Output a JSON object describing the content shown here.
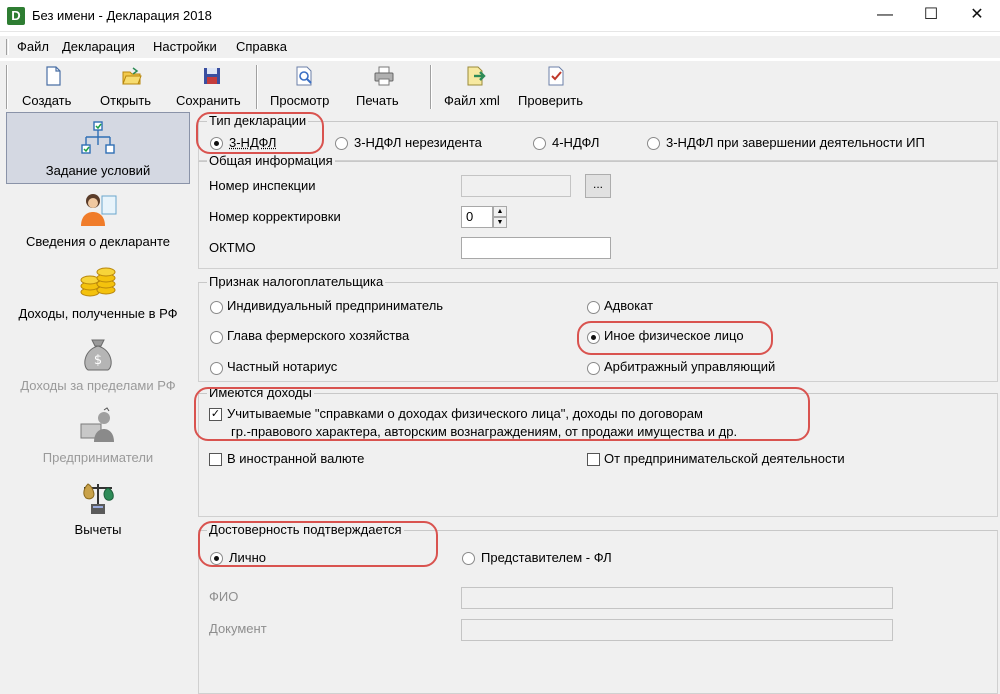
{
  "window": {
    "app_icon": "D",
    "title": "Без имени - Декларация 2018",
    "minimize": "—",
    "maximize": "☐",
    "close": "✕"
  },
  "menu": [
    "Файл",
    "Декларация",
    "Настройки",
    "Справка"
  ],
  "toolbar": {
    "create": "Создать",
    "open": "Открыть",
    "save": "Сохранить",
    "preview": "Просмотр",
    "print": "Печать",
    "xml": "Файл xml",
    "check": "Проверить"
  },
  "sidebar": {
    "items": [
      {
        "label": "Задание условий",
        "icon": "tree-icon"
      },
      {
        "label": "Сведения о декларанте",
        "icon": "person-icon"
      },
      {
        "label": "Доходы, полученные в РФ",
        "icon": "coins-icon"
      },
      {
        "label": "Доходы за пределами РФ",
        "icon": "money-bag-icon"
      },
      {
        "label": "Предприниматели",
        "icon": "entrepreneur-icon"
      },
      {
        "label": "Вычеты",
        "icon": "scales-icon"
      }
    ]
  },
  "decl_type": {
    "title": "Тип декларации",
    "options": [
      "3-НДФЛ",
      "3-НДФЛ нерезидента",
      "4-НДФЛ",
      "3-НДФЛ при завершении деятельности ИП"
    ],
    "selected": "3-НДФЛ"
  },
  "general": {
    "title": "Общая информация",
    "inspection_label": "Номер инспекции",
    "inspection_value": "",
    "browse_button": "...",
    "correction_label": "Номер корректировки",
    "correction_value": "0",
    "oktmo_label": "ОКТМО",
    "oktmo_value": ""
  },
  "taxpayer": {
    "title": "Признак налогоплательщика",
    "options": [
      "Индивидуальный предприниматель",
      "Адвокат",
      "Глава фермерского хозяйства",
      "Иное физическое лицо",
      "Частный нотариус",
      "Арбитражный управляющий"
    ],
    "selected": "Иное физическое лицо"
  },
  "income": {
    "title": "Имеются доходы",
    "main_line1": "Учитываемые \"справками о доходах физического лица\", доходы по договорам",
    "main_line2": "гр.-правового характера, авторским вознаграждениям, от продажи имущества и др.",
    "main_checked": true,
    "foreign_currency": "В иностранной валюте",
    "business": "От предпринимательской деятельности"
  },
  "confirm": {
    "title": "Достоверность подтверждается",
    "personally": "Лично",
    "representative": "Представителем - ФЛ",
    "fio_label": "ФИО",
    "doc_label": "Документ",
    "selected": "Лично"
  },
  "colors": {
    "highlight": "#d9534f",
    "panel": "#f0f0f0",
    "active_nav": "#d4d8e2"
  }
}
